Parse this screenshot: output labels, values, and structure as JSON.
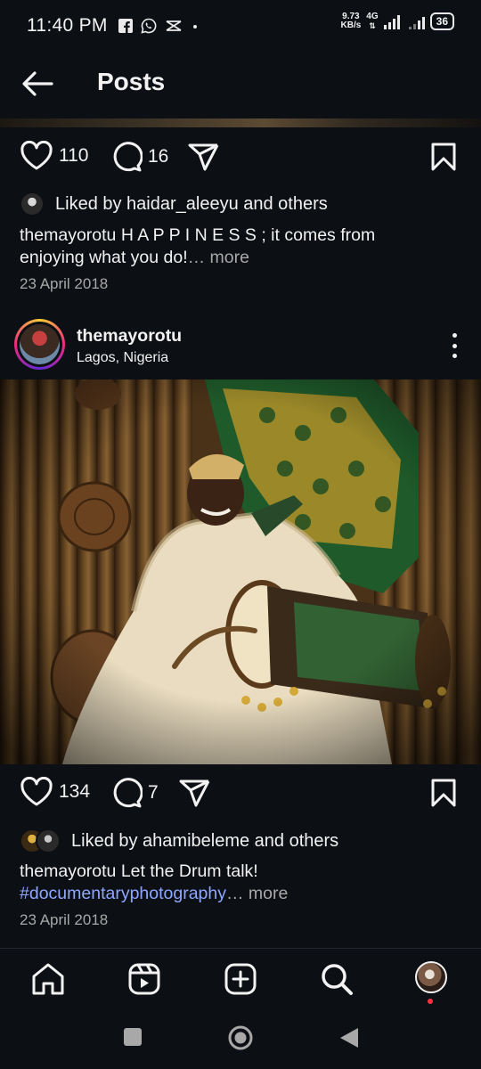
{
  "status_bar": {
    "time": "11:40 PM",
    "net_speed_value": "9.73",
    "net_speed_unit": "KB/s",
    "network": "4G",
    "battery": "36"
  },
  "header": {
    "title": "Posts"
  },
  "post1": {
    "likes": "110",
    "comments": "16",
    "liked_by": "Liked by haidar_aleeyu and others",
    "caption_user": "themayorotu",
    "caption_text_1": " H A P P I N E S S ; it comes from",
    "caption_text_2": "enjoying what you do!",
    "more": "… more",
    "date": "23 April 2018"
  },
  "post2": {
    "username": "themayorotu",
    "location": "Lagos, Nigeria",
    "likes": "134",
    "comments": "7",
    "liked_by": "Liked by ahamibeleme and others",
    "caption_user": "themayorotu",
    "caption_text": " Let the Drum talk!",
    "hashtag": "#documentaryphotography",
    "more": "… more",
    "date": "23 April 2018"
  },
  "colors": {
    "background": "#0c0f14",
    "text": "#f2f2f2",
    "muted": "#a8a8a8",
    "hashtag": "#8fa7ff",
    "notification": "#ff3040"
  },
  "icons": {
    "back": "arrow-left-icon",
    "like": "heart-icon",
    "comment": "comment-bubble-icon",
    "share": "paper-plane-icon",
    "save": "bookmark-icon",
    "home": "home-icon",
    "reels": "reels-icon",
    "create": "plus-square-icon",
    "search": "search-icon"
  }
}
